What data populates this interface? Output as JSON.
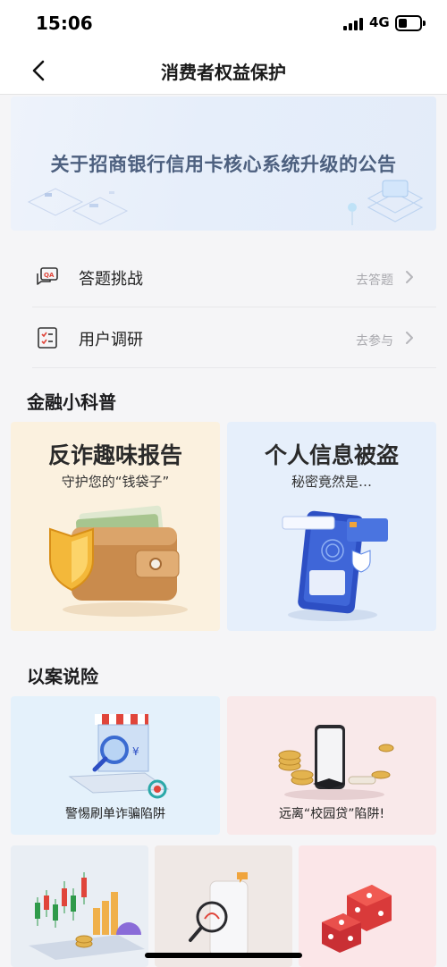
{
  "status_bar": {
    "time": "15:06",
    "network": "4G"
  },
  "nav": {
    "title": "消费者权益保护",
    "back_icon": "chevron-left-icon"
  },
  "banner": {
    "text": "关于招商银行信用卡核心系统升级的公告"
  },
  "menu": [
    {
      "label": "答题挑战",
      "action": "去答题",
      "icon": "qa-chat-icon"
    },
    {
      "label": "用户调研",
      "action": "去参与",
      "icon": "checklist-icon"
    }
  ],
  "finance_section": {
    "title": "金融小科普",
    "cards": [
      {
        "title": "反诈趣味报告",
        "subtitle": "守护您的“钱袋子”",
        "bg": "#fbf1df"
      },
      {
        "title": "个人信息被盗",
        "subtitle": "秘密竟然是…",
        "bg": "#e6effb"
      }
    ]
  },
  "case_section": {
    "title": "以案说险",
    "cards": [
      {
        "label": "警惕刷单诈骗陷阱",
        "bg": "#e4f1fb"
      },
      {
        "label": "远离“校园贷”陷阱!",
        "bg": "#f9e9ea"
      }
    ]
  },
  "colors": {
    "accent_red": "#e0453a",
    "text_muted": "#a8a8ad"
  }
}
